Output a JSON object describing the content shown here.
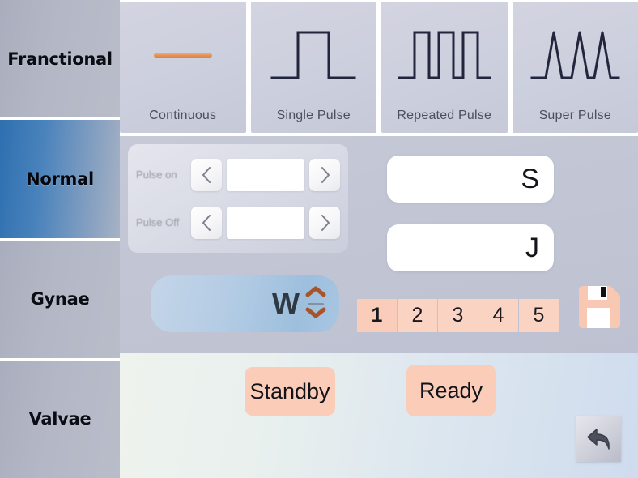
{
  "sidebar": {
    "items": [
      {
        "label": "Franctional",
        "selected": false,
        "name": "sidebar-item-franctional"
      },
      {
        "label": "Normal",
        "selected": true,
        "name": "sidebar-item-normal"
      },
      {
        "label": "Gynae",
        "selected": false,
        "name": "sidebar-item-gynae"
      },
      {
        "label": "Valvae",
        "selected": false,
        "name": "sidebar-item-valvae"
      }
    ]
  },
  "modes": {
    "items": [
      {
        "label": "Continuous",
        "icon": "continuous-wave-icon",
        "selected": false
      },
      {
        "label": "Single Pulse",
        "icon": "single-pulse-wave-icon",
        "selected": false
      },
      {
        "label": "Repeated Pulse",
        "icon": "repeated-pulse-wave-icon",
        "selected": false
      },
      {
        "label": "Super Pulse",
        "icon": "super-pulse-wave-icon",
        "selected": false
      }
    ]
  },
  "pulse_panel": {
    "rows": [
      {
        "label": "Pulse on",
        "value": "",
        "prev_icon": "chevron-left-icon",
        "next_icon": "chevron-right-icon"
      },
      {
        "label": "Pulse Off",
        "value": "",
        "prev_icon": "chevron-left-icon",
        "next_icon": "chevron-right-icon"
      }
    ]
  },
  "readouts": {
    "duration": {
      "value": "",
      "unit": "S"
    },
    "energy": {
      "value": "",
      "unit": "J"
    }
  },
  "power": {
    "value": "",
    "unit": "W",
    "increase_icon": "chevron-up-icon",
    "decrease_icon": "chevron-down-icon"
  },
  "presets": {
    "items": [
      {
        "label": "1",
        "active": true
      },
      {
        "label": "2",
        "active": false
      },
      {
        "label": "3",
        "active": false
      },
      {
        "label": "4",
        "active": false
      },
      {
        "label": "5",
        "active": false
      }
    ]
  },
  "save": {
    "icon": "floppy-disk-save-icon"
  },
  "actions": {
    "standby": "Standby",
    "ready": "Ready",
    "back_icon": "back-arrow-icon"
  },
  "colors": {
    "accent_orange": "#e2904f",
    "accent_peach": "#fbcdb9",
    "selected_blue": "#2e6fb0",
    "waveform_navy": "#23253c",
    "sidebar_gray": "#b4b8c6"
  }
}
